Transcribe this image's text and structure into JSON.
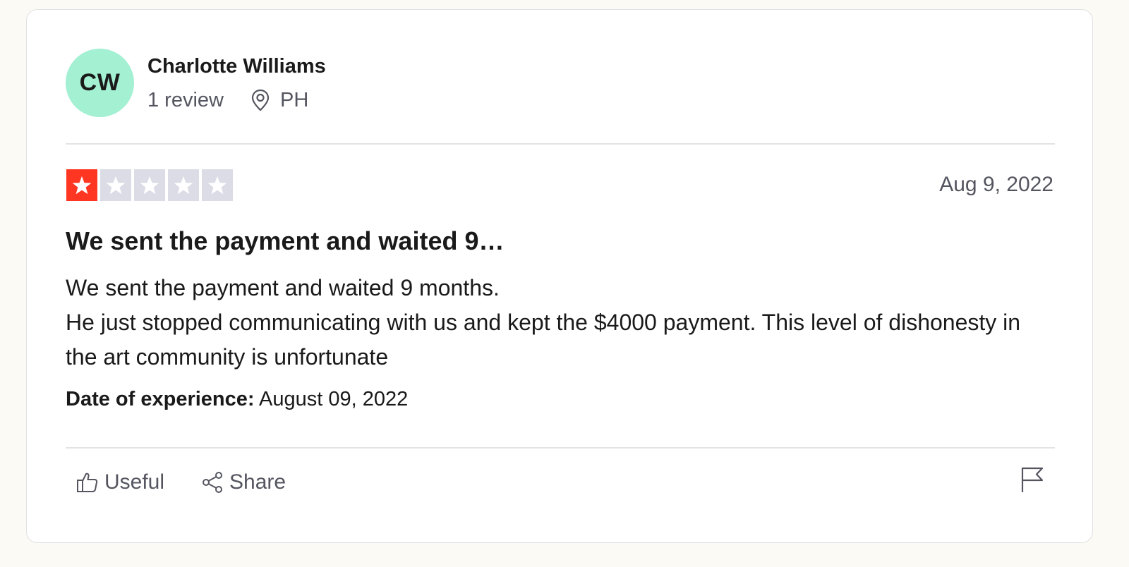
{
  "consumer": {
    "initials": "CW",
    "name": "Charlotte Williams",
    "reviews_count": "1 review",
    "location": "PH",
    "avatar_color": "#a3f0d3"
  },
  "review": {
    "rating": 1,
    "max_rating": 5,
    "star_filled_color": "#ff3722",
    "star_empty_color": "#dcdce6",
    "date": "Aug 9, 2022",
    "title": "We sent the payment and waited 9…",
    "body_lines": [
      "We sent the payment and waited 9 months.",
      "He just stopped communicating with us and kept the $4000 payment. This level of dishonesty in the art community is unfortunate"
    ],
    "experience_label": "Date of experience:",
    "experience_date": "August 09, 2022"
  },
  "actions": {
    "useful_label": "Useful",
    "share_label": "Share",
    "flag_icon": "flag-icon"
  },
  "icons": {
    "location": "location-pin-icon",
    "useful": "thumbs-up-icon",
    "share": "share-icon"
  }
}
